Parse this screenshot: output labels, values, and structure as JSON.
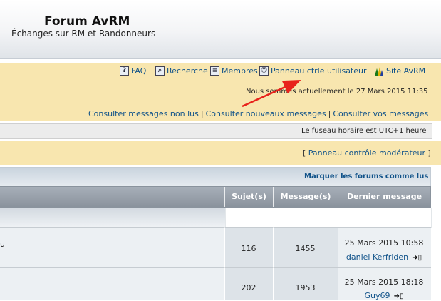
{
  "header": {
    "title": "Forum AvRM",
    "description": "Échanges sur RM et Randonneurs"
  },
  "nav": {
    "faq": "FAQ",
    "search": "Recherche",
    "members": "Membres",
    "control_panel": "Panneau ctrle utilisateur",
    "site": "Site AvRM"
  },
  "info": {
    "date_line": "Nous sommes actuellement le 27 Mars 2015 11:35",
    "unread": "Consulter messages non lus",
    "new_messages": "Consulter nouveaux messages",
    "your_messages": "Consulter vos messages",
    "separator": "|",
    "timezone": "Le fuseau horaire est UTC+1 heure"
  },
  "moderator": {
    "bracket_open": "[",
    "label": "Panneau contrôle modérateur",
    "bracket_close": "]"
  },
  "forum": {
    "mark_read": "Marquer les forums comme lus",
    "columns": [
      "Sujet(s)",
      "Message(s)",
      "Dernier message"
    ],
    "row1_fragment": "u",
    "rows": [
      {
        "topics": "116",
        "posts": "1455",
        "last_date": "25 Mars 2015 10:58",
        "last_user": "daniel Kerfriden"
      },
      {
        "topics": "202",
        "posts": "1953",
        "last_date": "25 Mars 2015 18:18",
        "last_user": "Guy69"
      }
    ]
  },
  "colors": {
    "link": "#105289",
    "nav_panel": "#f8e6af",
    "table_header": "#98a1ab",
    "annotation_arrow": "#e8231c"
  }
}
